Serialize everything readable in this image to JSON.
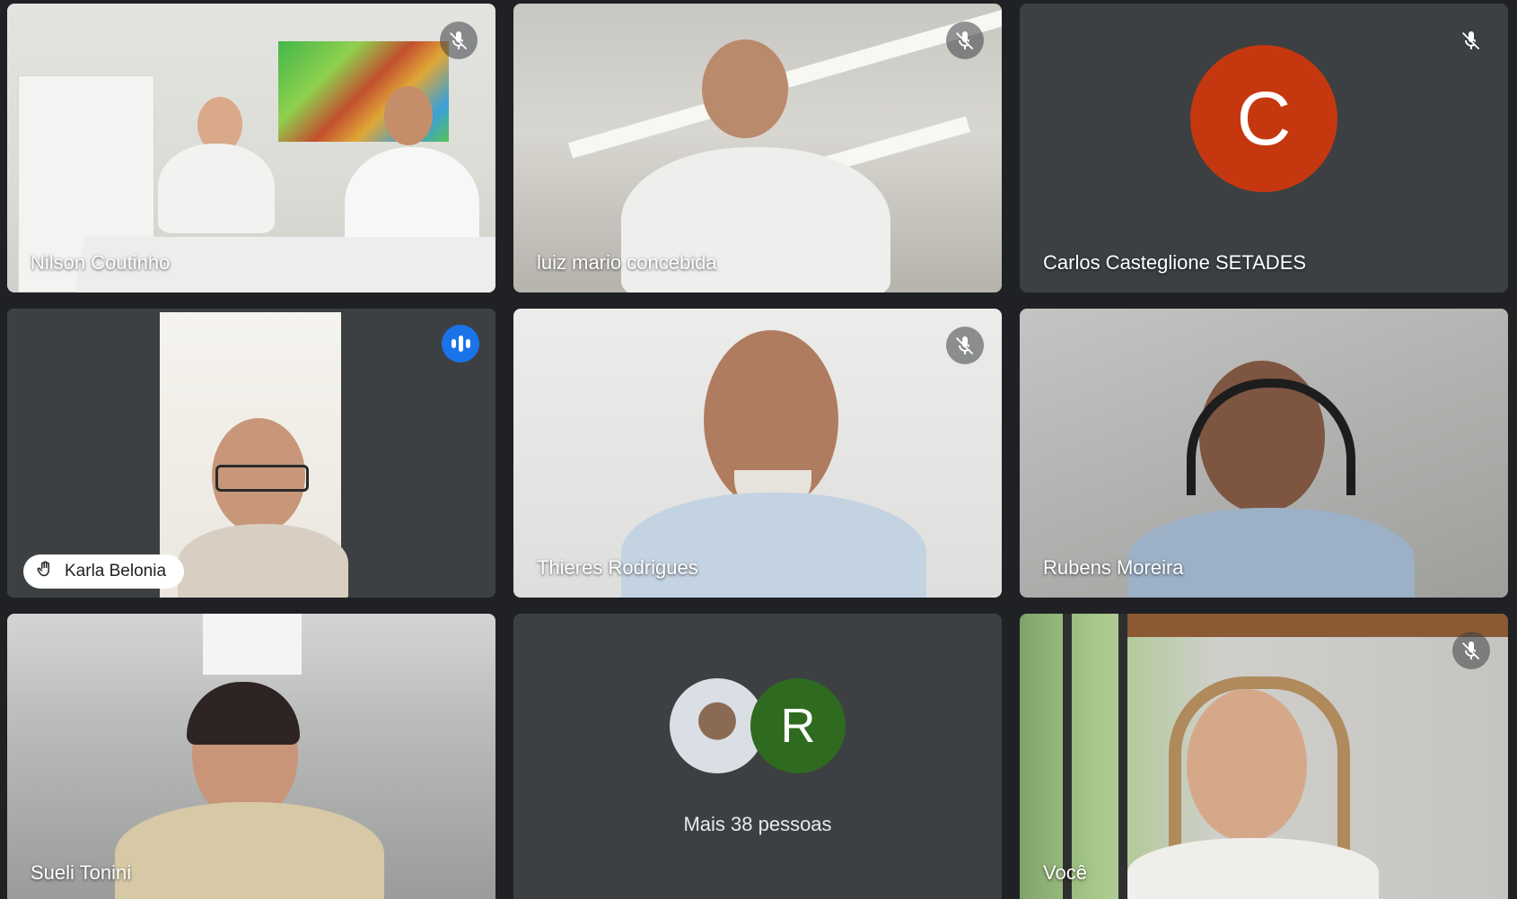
{
  "participants": [
    {
      "name": "Nilson Coutinho",
      "muted": true
    },
    {
      "name": "luiz mario concebida",
      "muted": true
    },
    {
      "name": "Carlos Casteglione SETADES",
      "muted": true,
      "avatar_letter": "C",
      "avatar_color": "#c5380f"
    },
    {
      "name": "Karla Belonia",
      "speaking": true,
      "hand_raised": true
    },
    {
      "name": "Thieres Rodrigues",
      "muted": true
    },
    {
      "name": "Rubens Moreira",
      "muted": false
    },
    {
      "name": "Sueli Tonini",
      "muted": false
    },
    {
      "name": "Você",
      "muted": true
    }
  ],
  "overflow": {
    "label": "Mais 38 pessoas",
    "avatar_letter": "R",
    "avatar_color": "#2e6a1f"
  },
  "colors": {
    "background": "#202124",
    "tile": "#3c4043",
    "active_border": "#8ab4f8",
    "speaking_indicator": "#1a73e8"
  }
}
